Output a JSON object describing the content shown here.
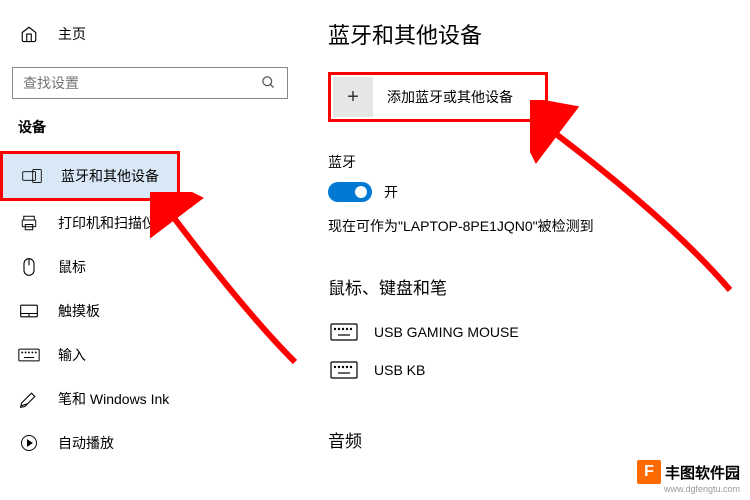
{
  "sidebar": {
    "home_label": "主页",
    "search_placeholder": "查找设置",
    "section_title": "设备",
    "items": [
      {
        "label": "蓝牙和其他设备",
        "selected": true
      },
      {
        "label": "打印机和扫描仪"
      },
      {
        "label": "鼠标"
      },
      {
        "label": "触摸板"
      },
      {
        "label": "输入"
      },
      {
        "label": "笔和 Windows Ink"
      },
      {
        "label": "自动播放"
      }
    ]
  },
  "main": {
    "page_title": "蓝牙和其他设备",
    "add_device_label": "添加蓝牙或其他设备",
    "bluetooth_label": "蓝牙",
    "toggle_status": "开",
    "discover_text": "现在可作为\"LAPTOP-8PE1JQN0\"被检测到",
    "section_mouse_kb_pen": "鼠标、键盘和笔",
    "devices": [
      {
        "name": "USB GAMING MOUSE"
      },
      {
        "name": "USB KB"
      }
    ],
    "section_audio": "音频"
  },
  "watermark": {
    "logo_letter": "F",
    "text": "丰图软件园",
    "url": "www.dgfengtu.com"
  }
}
